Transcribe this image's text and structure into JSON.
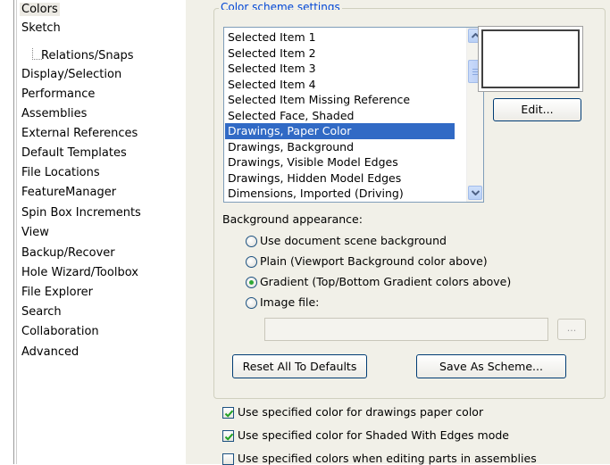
{
  "tree": {
    "items": [
      {
        "label": "Colors",
        "selected": true
      },
      {
        "label": "Sketch"
      },
      {
        "label": "Relations/Snaps",
        "child": true
      },
      {
        "label": "Display/Selection"
      },
      {
        "label": "Performance"
      },
      {
        "label": "Assemblies"
      },
      {
        "label": "External References"
      },
      {
        "label": "Default Templates"
      },
      {
        "label": "File Locations"
      },
      {
        "label": "FeatureManager"
      },
      {
        "label": "Spin Box Increments"
      },
      {
        "label": "View"
      },
      {
        "label": "Backup/Recover"
      },
      {
        "label": "Hole Wizard/Toolbox"
      },
      {
        "label": "File Explorer"
      },
      {
        "label": "Search"
      },
      {
        "label": "Collaboration"
      },
      {
        "label": "Advanced"
      }
    ]
  },
  "color_scheme": {
    "legend": "Color scheme settings",
    "items": [
      "Selected Item 1",
      "Selected Item 2",
      "Selected Item 3",
      "Selected Item 4",
      "Selected Item Missing Reference",
      "Selected Face, Shaded",
      "Drawings, Paper Color",
      "Drawings, Background",
      "Drawings, Visible Model Edges",
      "Drawings, Hidden Model Edges",
      "Dimensions, Imported (Driving)"
    ],
    "selected_item": "Drawings, Paper Color",
    "swatch_color": "#ffffff",
    "edit_button": "Edit..."
  },
  "background": {
    "label": "Background appearance:",
    "options": [
      {
        "label": "Use document scene background",
        "checked": false
      },
      {
        "label": "Plain (Viewport Background color above)",
        "checked": false
      },
      {
        "label": "Gradient (Top/Bottom Gradient colors above)",
        "checked": true
      },
      {
        "label": "Image file:",
        "checked": false
      }
    ],
    "image_file_value": "",
    "browse_label": "..."
  },
  "buttons": {
    "reset": "Reset All To Defaults",
    "save_scheme": "Save As Scheme..."
  },
  "checkboxes": [
    {
      "label": "Use specified color for drawings paper color",
      "checked": true
    },
    {
      "label": "Use specified color for Shaded With Edges mode",
      "checked": true
    },
    {
      "label": "Use specified colors when editing parts in assemblies",
      "checked": false
    }
  ],
  "colors": {
    "selection_blue": "#316ac5",
    "legend_blue": "#0046d5",
    "panel_bg": "#f1f0e8",
    "radio_green": "#2fa835",
    "check_green": "#21a121"
  }
}
